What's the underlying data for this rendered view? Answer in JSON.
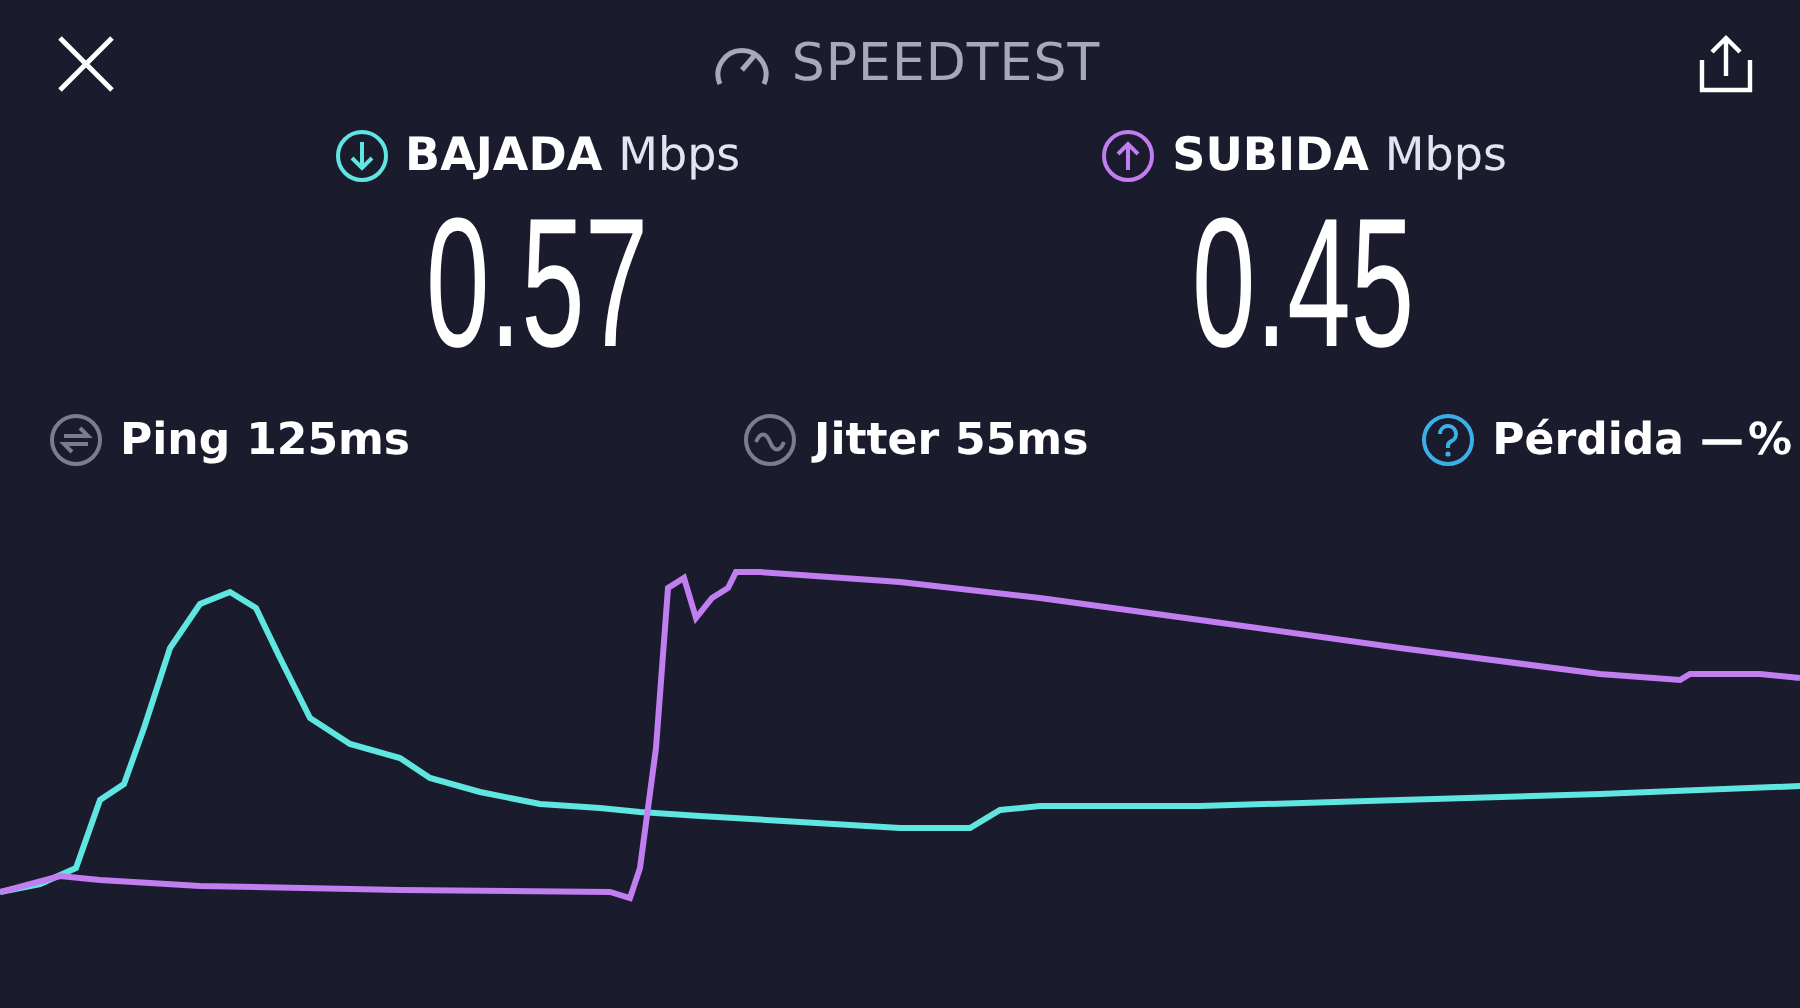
{
  "header": {
    "title": "SPEEDTEST"
  },
  "speeds": [
    {
      "kind": "download",
      "label": "BAJADA",
      "unit": "Mbps",
      "value": "0.57"
    },
    {
      "kind": "upload",
      "label": "SUBIDA",
      "unit": "Mbps",
      "value": "0.45"
    }
  ],
  "metrics": [
    {
      "kind": "ping",
      "label": "Ping",
      "value": "125ms"
    },
    {
      "kind": "jitter",
      "label": "Jitter",
      "value": "55ms"
    },
    {
      "kind": "loss",
      "label": "Pérdida",
      "value": "—",
      "unit": "%"
    }
  ]
}
